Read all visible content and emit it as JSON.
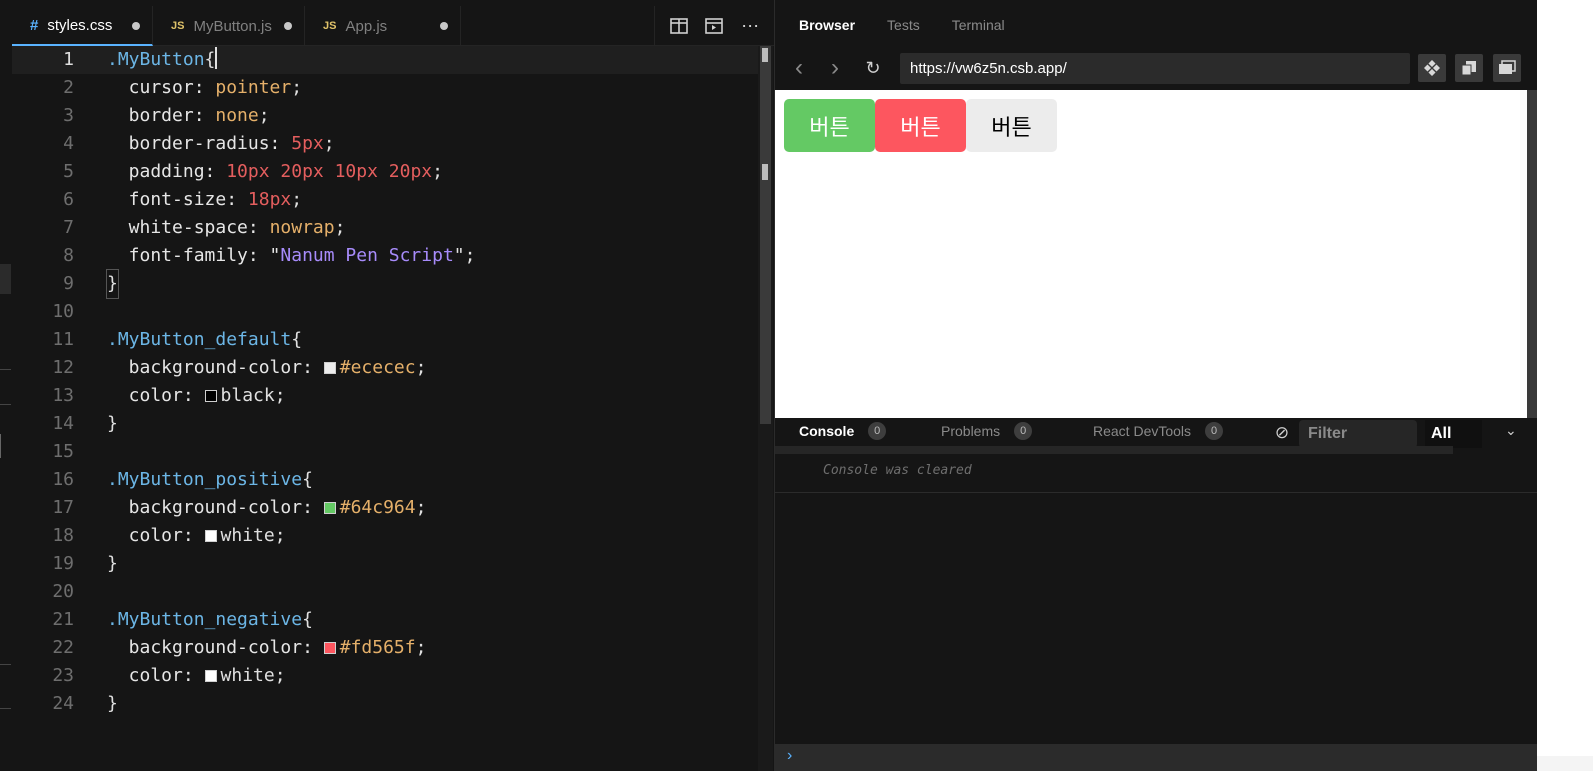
{
  "editor": {
    "tabs": [
      {
        "type": "#",
        "label": "styles.css"
      },
      {
        "type": "JS",
        "label": "MyButton.js"
      },
      {
        "type": "JS",
        "label": "App.js"
      }
    ],
    "actions": {
      "split": "split-icon",
      "preview": "preview-icon",
      "more": "⋯"
    },
    "lines": [
      {
        "n": "1"
      },
      {
        "n": "2"
      },
      {
        "n": "3"
      },
      {
        "n": "4"
      },
      {
        "n": "5"
      },
      {
        "n": "6"
      },
      {
        "n": "7"
      },
      {
        "n": "8"
      },
      {
        "n": "9"
      },
      {
        "n": "10"
      },
      {
        "n": "11"
      },
      {
        "n": "12"
      },
      {
        "n": "13"
      },
      {
        "n": "14"
      },
      {
        "n": "15"
      },
      {
        "n": "16"
      },
      {
        "n": "17"
      },
      {
        "n": "18"
      },
      {
        "n": "19"
      },
      {
        "n": "20"
      },
      {
        "n": "21"
      },
      {
        "n": "22"
      },
      {
        "n": "23"
      },
      {
        "n": "24"
      }
    ],
    "code": {
      "l1_sel": ".MyButton",
      "l1_brace": "{",
      "l2_prop": "  cursor: ",
      "l2_val": "pointer",
      "l2_end": ";",
      "l3_prop": "  border: ",
      "l3_val": "none",
      "l3_end": ";",
      "l4_prop": "  border-radius: ",
      "l4_val": "5px",
      "l4_end": ";",
      "l5_prop": "  padding: ",
      "l5_val": "10px 20px 10px 20px",
      "l5_end": ";",
      "l6_prop": "  font-size: ",
      "l6_val": "18px",
      "l6_end": ";",
      "l7_prop": "  white-space: ",
      "l7_val": "nowrap",
      "l7_end": ";",
      "l8_prop": "  font-family: \"",
      "l8_val": "Nanum Pen Script",
      "l8_end": "\";",
      "l9": "}",
      "l11_sel": ".MyButton_default",
      "l11_brace": "{",
      "l12_prop": "  background-color: ",
      "l12_val": "#ececec",
      "l12_end": ";",
      "l13_prop": "  color: ",
      "l13_val": "black",
      "l13_end": ";",
      "l14": "}",
      "l16_sel": ".MyButton_positive",
      "l16_brace": "{",
      "l17_prop": "  background-color: ",
      "l17_val": "#64c964",
      "l17_end": ";",
      "l18_prop": "  color: ",
      "l18_val": "white",
      "l18_end": ";",
      "l19": "}",
      "l21_sel": ".MyButton_negative",
      "l21_brace": "{",
      "l22_prop": "  background-color: ",
      "l22_val": "#fd565f",
      "l22_end": ";",
      "l23_prop": "  color: ",
      "l23_val": "white",
      "l23_end": ";",
      "l24": "}"
    },
    "swatches": {
      "ececec": "#ececec",
      "black": "#000000",
      "green": "#64c964",
      "white": "#ffffff",
      "red": "#fd565f"
    }
  },
  "browser": {
    "tabs": [
      "Browser",
      "Tests",
      "Terminal"
    ],
    "nav": {
      "back": "‹",
      "forward": "›",
      "reload": "↻"
    },
    "url": "https://vw6z5n.csb.app/",
    "preview_buttons": [
      {
        "label": "버튼",
        "bg": "#64c964",
        "fg": "#ffffff"
      },
      {
        "label": "버튼",
        "bg": "#fd565f",
        "fg": "#ffffff"
      },
      {
        "label": "버튼",
        "bg": "#ececec",
        "fg": "#000000"
      }
    ]
  },
  "console": {
    "tabs": [
      {
        "label": "Console",
        "count": "0"
      },
      {
        "label": "Problems",
        "count": "0"
      },
      {
        "label": "React DevTools",
        "count": "0"
      }
    ],
    "filter_placeholder": "Filter",
    "level": "All",
    "message": "Console was cleared",
    "prompt": "›"
  }
}
